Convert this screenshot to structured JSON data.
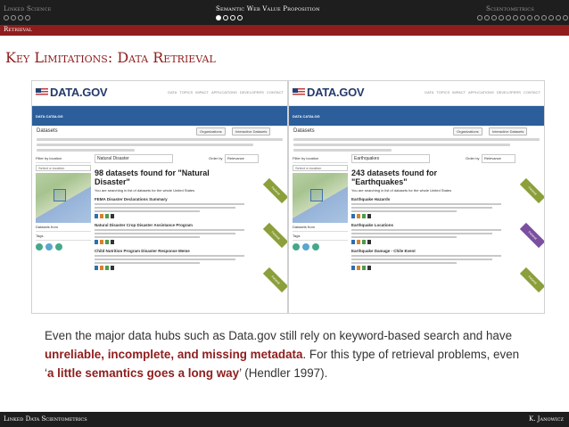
{
  "header": {
    "sections": [
      {
        "label": "Linked Science",
        "dots": 4,
        "filled": -1,
        "active": false
      },
      {
        "label": "Semantic Web Value Proposition",
        "dots": 4,
        "filled": 0,
        "active": true
      },
      {
        "label": "Scientometrics",
        "dots": 14,
        "filled": -1,
        "active": false
      }
    ],
    "subsection": "Retrieval"
  },
  "slide": {
    "title": "Key Limitations: Data Retrieval"
  },
  "screenshots": [
    {
      "logo": "DATA.GOV",
      "nav": [
        "DATA",
        "TOPICS",
        "IMPACT",
        "APPLICATIONS",
        "DEVELOPERS",
        "CONTACT"
      ],
      "band": "DATA CATALOG",
      "crumb": "Datasets",
      "btn1": "Organizations",
      "btn2": "Interactive Datasets",
      "filter_label": "Filter by location",
      "filter_select": "Select a location",
      "search_value": "Natural Disaster",
      "sort_label": "Order by",
      "sort_value": "Relevance",
      "count_text": "98 datasets found for \"Natural Disaster\"",
      "note": "You are searching in list of datasets for the whole United States",
      "datasets_label": "Datasets from",
      "tags_label": "Tags",
      "results": [
        {
          "title": "FEMA Disaster Declarations Summary"
        },
        {
          "title": "Natural Disaster Crop Disaster Assistance Program"
        },
        {
          "title": "Child Nutrition Program Disaster Response Meme"
        }
      ],
      "ribbon": "Federal"
    },
    {
      "logo": "DATA.GOV",
      "nav": [
        "DATA",
        "TOPICS",
        "IMPACT",
        "APPLICATIONS",
        "DEVELOPERS",
        "CONTACT"
      ],
      "band": "DATA CATALOG",
      "crumb": "Datasets",
      "btn1": "Organizations",
      "btn2": "Interactive Datasets",
      "filter_label": "Filter by location",
      "filter_select": "Select a location",
      "search_value": "Earthquakes",
      "sort_label": "Order by",
      "sort_value": "Relevance",
      "count_text": "243 datasets found for \"Earthquakes\"",
      "note": "You are searching in list of datasets for the whole United States",
      "datasets_label": "Datasets from",
      "tags_label": "Tags",
      "results": [
        {
          "title": "Earthquake Hazards"
        },
        {
          "title": "Earthquake Locations"
        },
        {
          "title": "Earthquake Damage - Chile Event"
        }
      ],
      "ribbon": "Federal"
    }
  ],
  "caption": {
    "p1": "Even the major data hubs such as Data.gov still rely on keyword-based search and have ",
    "h1": "unreliable, incomplete, and missing metadata",
    "p2": ". For this type of retrieval problems, even ‘",
    "h2": "a little semantics goes a long way",
    "p3": "’ (Hendler 1997)."
  },
  "footer": {
    "left": "Linked Data Scientometrics",
    "right": "K. Janowicz"
  }
}
